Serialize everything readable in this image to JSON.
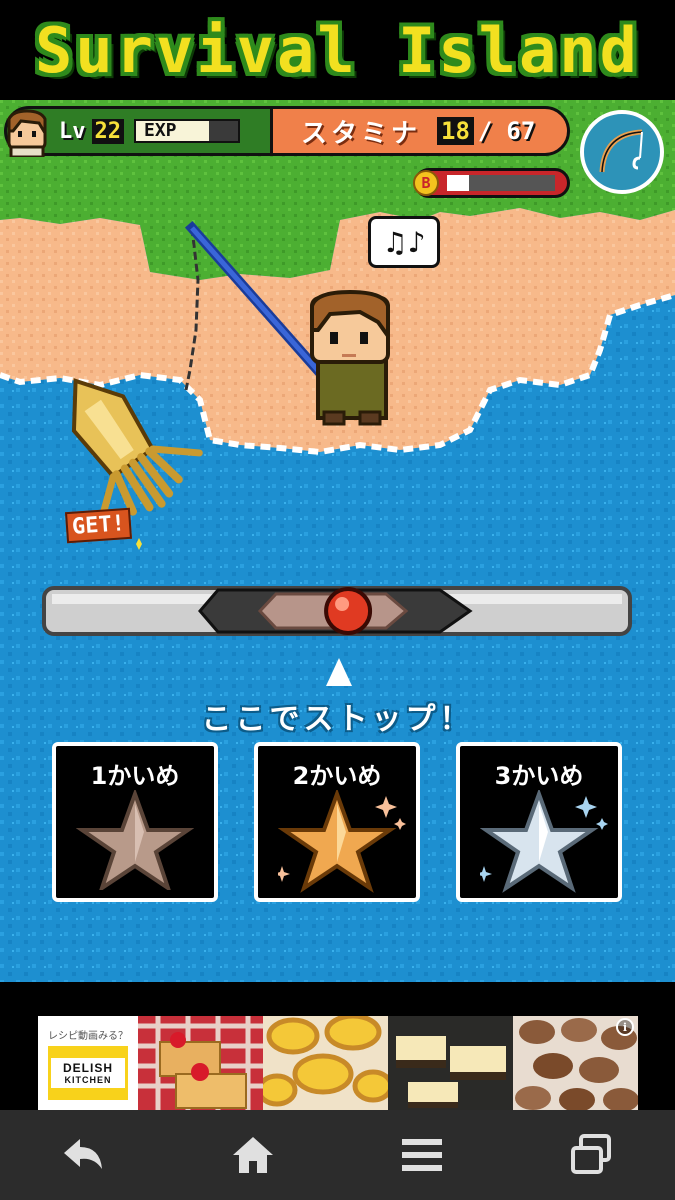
{
  "title": {
    "text": "Survival Island"
  },
  "hud": {
    "level_label": "Lv",
    "level_value": "22",
    "exp_label": "EXP",
    "exp_fraction": 0.72,
    "stamina_label": "スタミナ",
    "stamina_current": "18",
    "stamina_separator": "/",
    "stamina_max": "67",
    "bait_icon_letter": "B",
    "bait_fraction": 0.2
  },
  "speech": {
    "text": "♫♪"
  },
  "catch": {
    "get_label": "GET!"
  },
  "timing": {
    "instruction": "ここでストップ！",
    "marker_position": 0.52
  },
  "attempts": [
    {
      "label": "1かいめ",
      "star": "bronze-star"
    },
    {
      "label": "2かいめ",
      "star": "gold-star"
    },
    {
      "label": "3かいめ",
      "star": "silver-star"
    }
  ],
  "ad": {
    "prompt": "レシピ動画みる？",
    "logo_line1": "DELISH",
    "logo_line2": "KITCHEN",
    "info_icon": "i"
  },
  "colors": {
    "water": "#1d8fd0",
    "sand": "#f7b98a",
    "grass": "#4caf32",
    "hud_green": "#2f7d25",
    "hud_orange": "#f0804a",
    "title_yellow": "#f2e020"
  }
}
